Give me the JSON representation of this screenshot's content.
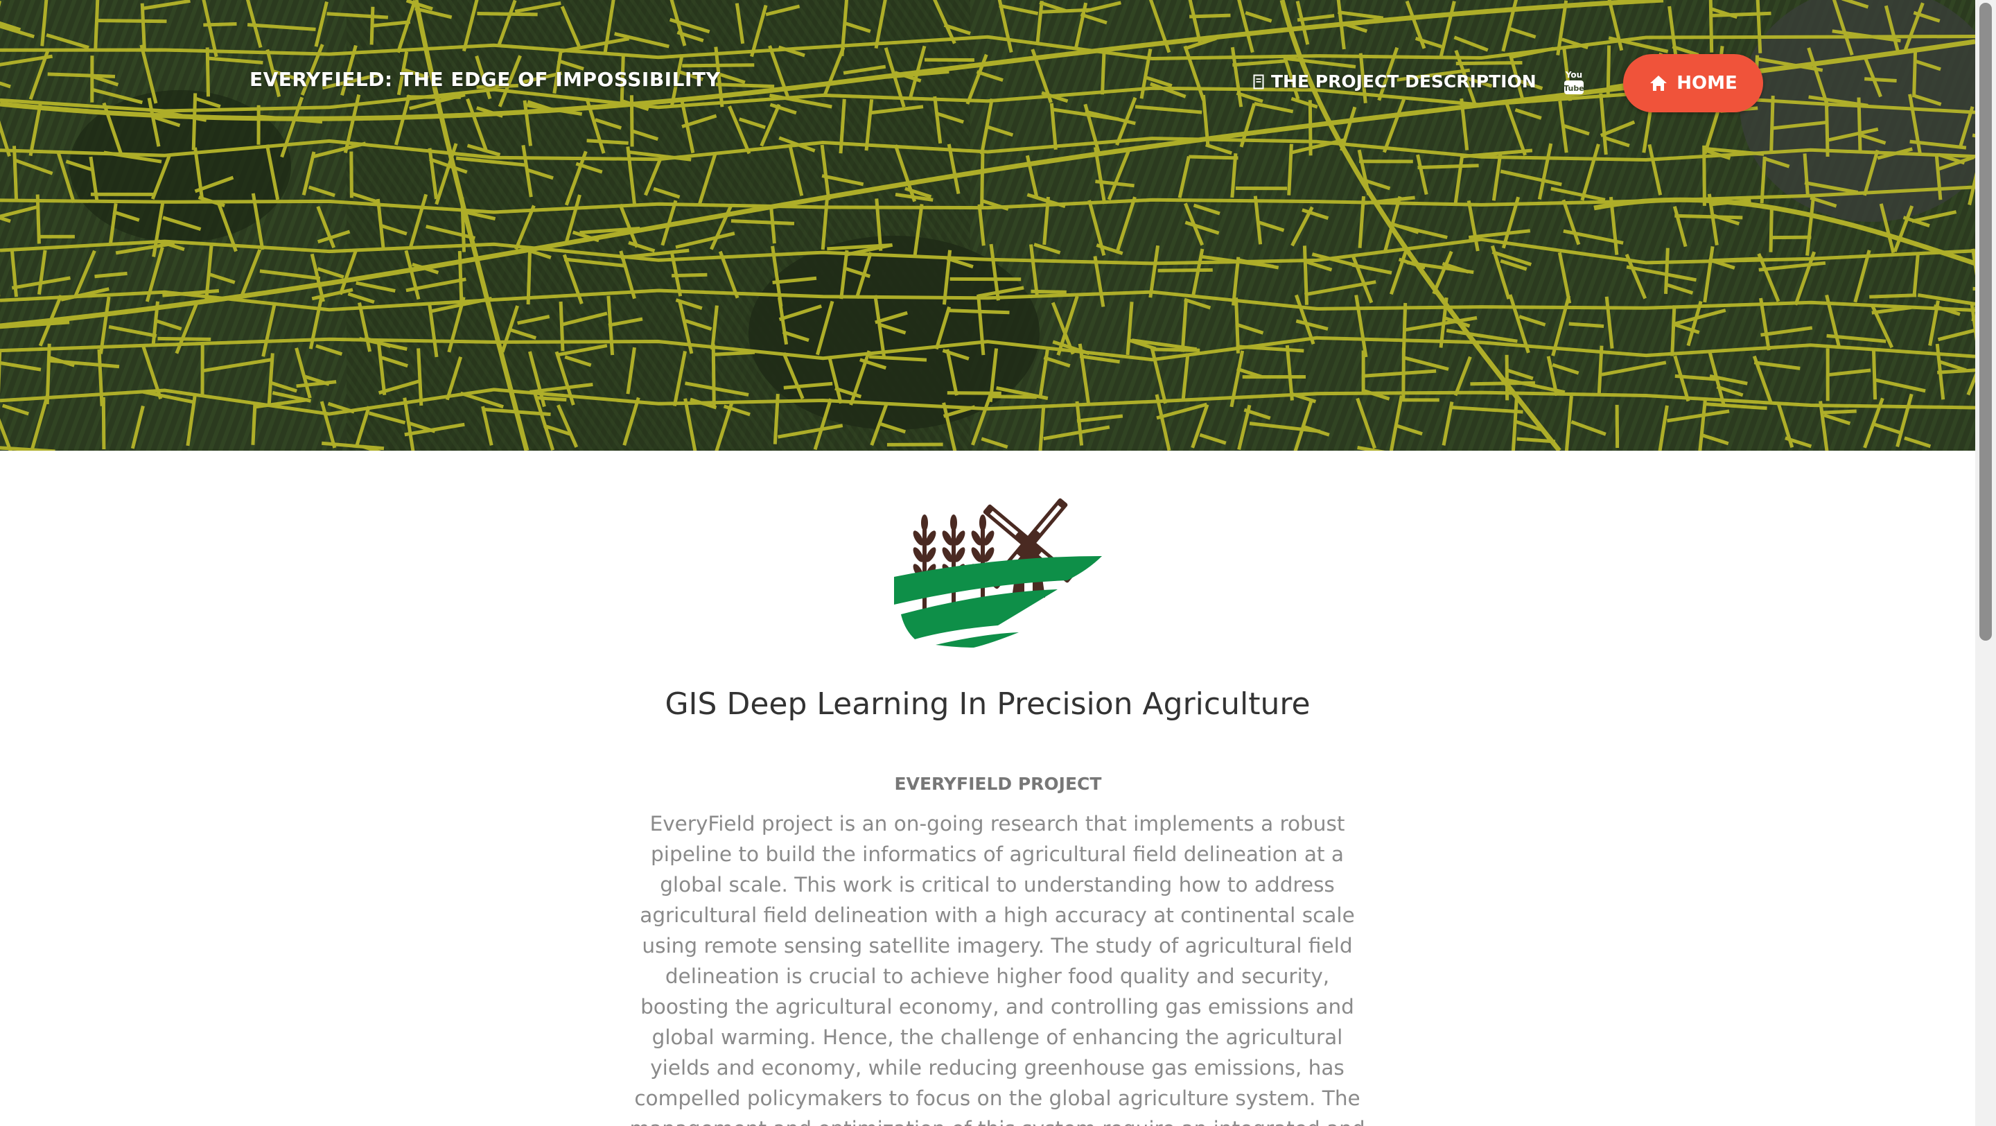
{
  "header": {
    "brand": "EVERYFIELD: THE EDGE OF IMPOSSIBILITY",
    "nav": {
      "project_description": "THE PROJECT DESCRIPTION",
      "youtube_icon": "youtube-icon",
      "home": "HOME"
    }
  },
  "main": {
    "title": "GIS Deep Learning In Precision Agriculture",
    "section_heading": "EVERYFIELD PROJECT",
    "description": "EveryField project is an on-going research that implements a robust pipeline to build the informatics of agricultural field delineation at a global scale. This work is critical to understanding how to address agricultural field delineation with a high accuracy at continental scale using remote sensing satellite imagery. The study of agricultural field delineation is crucial to achieve higher food quality and security, boosting the agricultural economy, and controlling gas emissions and global warming. Hence, the challenge of enhancing the agricultural yields and economy, while reducing greenhouse gas emissions, has compelled policymakers to focus on the global agriculture system. The management and optimization of this system require an integrated and"
  },
  "colors": {
    "accent": "#f0533a",
    "field_lines": "#b6b52a",
    "logo_brown": "#4a2a22",
    "logo_green": "#0e8f48"
  }
}
